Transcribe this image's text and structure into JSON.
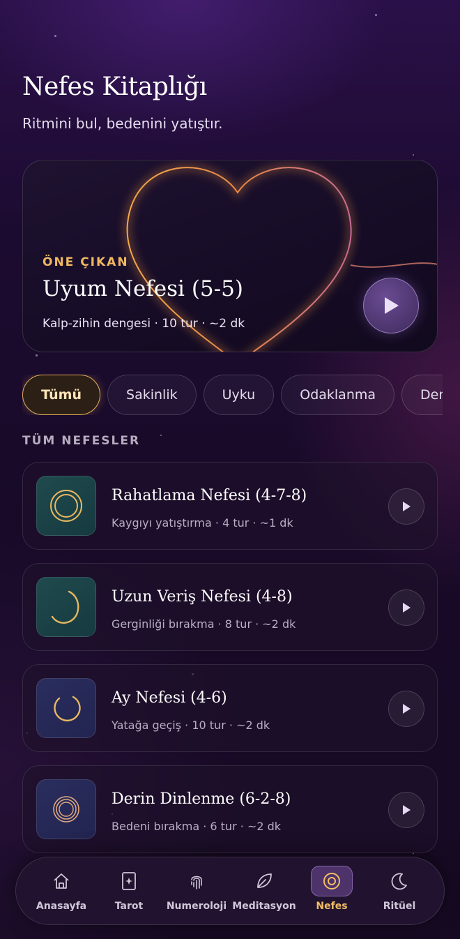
{
  "header": {
    "title": "Nefes Kitaplığı",
    "subtitle": "Ritmini bul, bedenini yatıştır."
  },
  "featured": {
    "tag": "ÖNE ÇIKAN",
    "title": "Uyum Nefesi (5-5)",
    "meta": "Kalp-zihin dengesi · 10 tur · ~2 dk",
    "play_icon": "play-icon"
  },
  "filters": [
    {
      "label": "Tümü",
      "active": true
    },
    {
      "label": "Sakinlik",
      "active": false
    },
    {
      "label": "Uyku",
      "active": false
    },
    {
      "label": "Odaklanma",
      "active": false
    },
    {
      "label": "Denge",
      "active": false
    }
  ],
  "section_label": "TÜM NEFESLER",
  "breaths": [
    {
      "title": "Rahatlama Nefesi (4-7-8)",
      "meta": "Kaygıyı yatıştırma · 4 tur · ~1 dk",
      "icon": "double-ring-icon"
    },
    {
      "title": "Uzun Veriş Nefesi (4-8)",
      "meta": "Gerginliği bırakma · 8 tur · ~2 dk",
      "icon": "arc-icon"
    },
    {
      "title": "Ay Nefesi (4-6)",
      "meta": "Yatağa geçiş · 10 tur · ~2 dk",
      "icon": "open-ring-icon"
    },
    {
      "title": "Derin Dinlenme (6-2-8)",
      "meta": "Bedeni bırakma · 6 tur · ~2 dk",
      "icon": "concentric-rings-icon"
    }
  ],
  "nav": [
    {
      "label": "Anasayfa",
      "icon": "home-icon",
      "active": false
    },
    {
      "label": "Tarot",
      "icon": "tarot-card-icon",
      "active": false
    },
    {
      "label": "Numeroloji",
      "icon": "fingerprint-icon",
      "active": false
    },
    {
      "label": "Meditasyon",
      "icon": "leaf-icon",
      "active": false
    },
    {
      "label": "Nefes",
      "icon": "breath-ring-icon",
      "active": true
    },
    {
      "label": "Ritüel",
      "icon": "moon-icon",
      "active": false
    }
  ],
  "colors": {
    "accent_gold": "#f0b862",
    "active_chip_border": "#e0ad5c",
    "nav_active": "#f3bd63",
    "background": "#1c0b30"
  }
}
